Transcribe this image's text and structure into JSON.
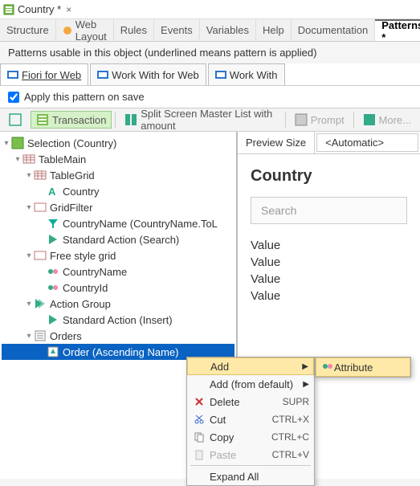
{
  "title": {
    "name": "Country *"
  },
  "tabs": [
    "Structure",
    "Web Layout",
    "Rules",
    "Events",
    "Variables",
    "Help",
    "Documentation",
    "Patterns *"
  ],
  "tabs_active": "Patterns *",
  "description": "Patterns usable in this object (underlined means pattern is applied)",
  "subtabs": [
    {
      "label": "Fiori for Web",
      "active": true
    },
    {
      "label": "Work With for Web",
      "active": false
    },
    {
      "label": "Work With",
      "active": false
    }
  ],
  "apply_label": "Apply this pattern on save",
  "apply_checked": true,
  "toolbar": {
    "transaction": "Transaction",
    "split": "Split Screen Master List with amount",
    "prompt": "Prompt",
    "more": "More..."
  },
  "tree": {
    "root": "Selection (Country)",
    "n_tablemain": "TableMain",
    "n_tablegrid": "TableGrid",
    "n_country": "Country",
    "n_gridfilter": "GridFilter",
    "n_countryname_f": "CountryName (CountryName.ToL",
    "n_std_search": "Standard Action (Search)",
    "n_freestyle": "Free style grid",
    "n_countryname": "CountryName",
    "n_countryid": "CountryId",
    "n_actiongroup": "Action Group",
    "n_std_insert": "Standard Action (Insert)",
    "n_orders": "Orders",
    "n_order_asc": "Order (Ascending Name)"
  },
  "preview": {
    "size_label": "Preview Size",
    "size_value": "<Automatic>",
    "heading": "Country",
    "search_placeholder": "Search",
    "values": [
      "Value",
      "Value",
      "Value",
      "Value"
    ]
  },
  "context_menu": {
    "add": "Add",
    "add_default": "Add (from default)",
    "delete": "Delete",
    "delete_k": "SUPR",
    "cut": "Cut",
    "cut_k": "CTRL+X",
    "copy": "Copy",
    "copy_k": "CTRL+C",
    "paste": "Paste",
    "paste_k": "CTRL+V",
    "expand": "Expand All"
  },
  "submenu": {
    "attribute": "Attribute"
  }
}
